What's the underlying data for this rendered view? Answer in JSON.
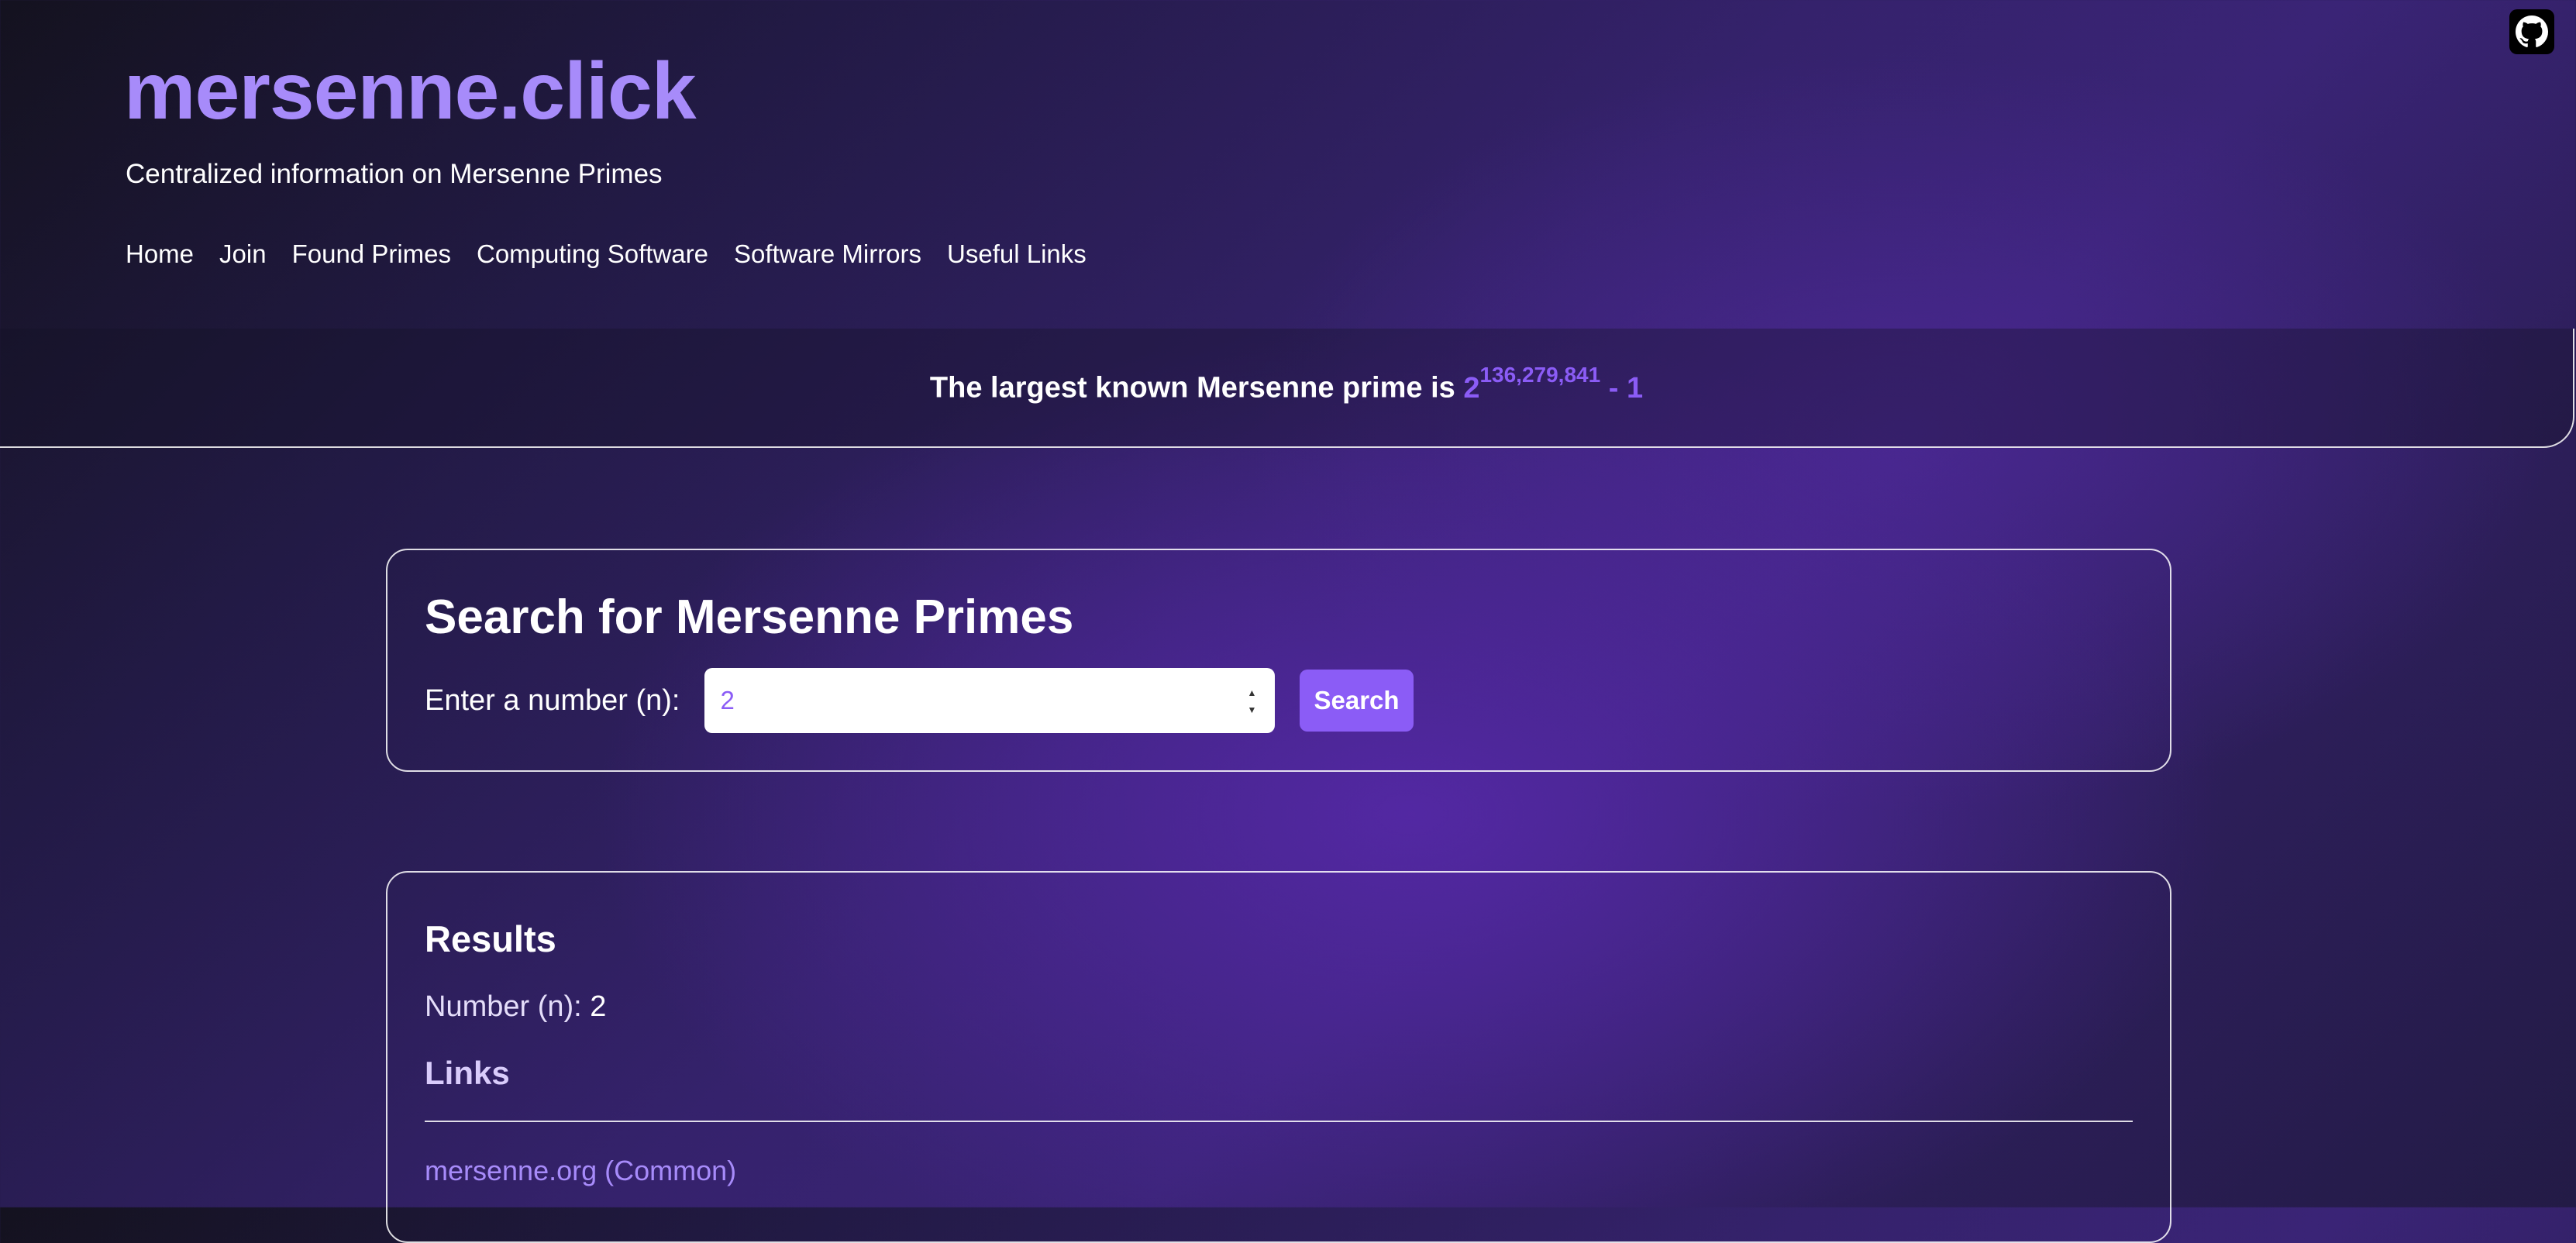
{
  "header": {
    "site_title": "mersenne.click",
    "tagline": "Centralized information on Mersenne Primes",
    "github_icon": "github-icon",
    "nav": [
      {
        "label": "Home"
      },
      {
        "label": "Join"
      },
      {
        "label": "Found Primes"
      },
      {
        "label": "Computing Software"
      },
      {
        "label": "Software Mirrors"
      },
      {
        "label": "Useful Links"
      }
    ]
  },
  "banner": {
    "text": "The largest known Mersenne prime is",
    "base": "2",
    "exponent": "136,279,841",
    "suffix": " - 1"
  },
  "search": {
    "title": "Search for Mersenne Primes",
    "label": "Enter a number (n):",
    "input_value": "2",
    "button_label": "Search"
  },
  "results": {
    "title": "Results",
    "number_label": "Number (n):",
    "number_value": "2",
    "links_heading": "Links",
    "links": [
      {
        "label": "mersenne.org (Common)"
      }
    ]
  },
  "colors": {
    "accent": "#8b5cf6",
    "title": "#a78bfa",
    "background_dark": "#14121f",
    "background_purple": "#3a2476"
  }
}
